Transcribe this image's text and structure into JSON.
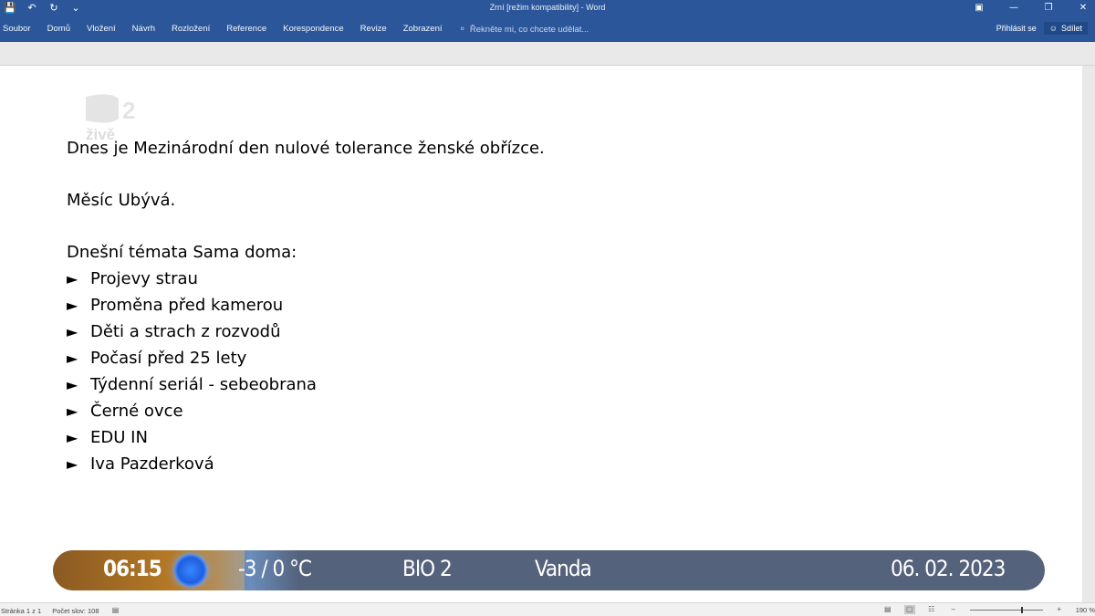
{
  "titlebar": {
    "title": "Zrní [režim kompatibility] - Word",
    "qat_icons": [
      "save-icon",
      "undo-icon",
      "redo-icon",
      "customize-icon"
    ],
    "window_icons": [
      "ribbon-display-icon",
      "minimize-icon",
      "restore-icon",
      "close-icon"
    ]
  },
  "ribbon": {
    "tabs": [
      "Soubor",
      "Domů",
      "Vložení",
      "Návrh",
      "Rozložení",
      "Reference",
      "Korespondence",
      "Revize",
      "Zobrazení"
    ],
    "tell_me": "Řekněte mi, co chcete udělat...",
    "sign_in": "Přihlásit se",
    "share": "Sdílet"
  },
  "watermark": {
    "text": "živě"
  },
  "document": {
    "line1": "Dnes je Mezinárodní den nulové tolerance ženské obřízce.",
    "line2": "Měsíc Ubývá.",
    "line3": "Dnešní témata Sama doma:",
    "bullet_symbol": "►",
    "bullets": [
      "Projevy strau",
      "Proměna před kamerou",
      "Děti a strach z rozvodů",
      "Počasí před 25 lety",
      "Týdenní seriál - sebeobrana",
      "Černé ovce",
      "EDU IN",
      "Iva Pazderková"
    ]
  },
  "ticker": {
    "time": "06:15",
    "temperature": "-3 / 0 °C",
    "channel": "BIO 2",
    "name_day": "Vanda",
    "date": "06. 02. 2023"
  },
  "statusbar": {
    "page": "Stránka 1 z 1",
    "words": "Počet slov: 108",
    "zoom": "190 %"
  },
  "colors": {
    "word_blue": "#2b579a",
    "ticker_bg": "#55627c",
    "ticker_gold": "#b47826"
  }
}
